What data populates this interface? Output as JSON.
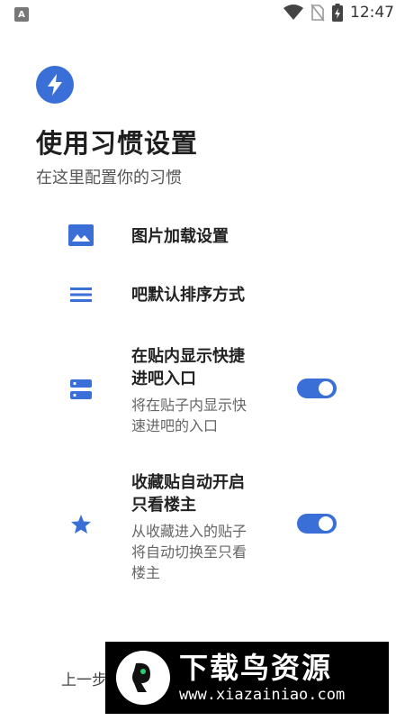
{
  "status_bar": {
    "notification_letter": "A",
    "time": "12:47",
    "icons": [
      "wifi-icon",
      "no-sim-icon",
      "battery-charging-icon"
    ]
  },
  "header": {
    "icon": "lightning-bolt-icon",
    "title": "使用习惯设置",
    "subtitle": "在这里配置你的习惯"
  },
  "settings": [
    {
      "icon": "image-icon",
      "title": "图片加载设置"
    },
    {
      "icon": "sort-list-icon",
      "title": "吧默认排序方式"
    },
    {
      "icon": "storage-icon",
      "title_lines": [
        "在贴内显示快捷",
        "进吧入口"
      ],
      "desc_lines": [
        "将在贴子内显示快",
        "速进吧的入口"
      ],
      "toggle_on": true
    },
    {
      "icon": "star-icon",
      "title_lines": [
        "收藏贴自动开启",
        "只看楼主"
      ],
      "desc_lines": [
        "从收藏进入的贴子",
        "将自动切换至只看",
        "楼主"
      ],
      "toggle_on": true
    }
  ],
  "footer": {
    "prev_label": "上一步"
  },
  "watermark": {
    "title": "下载鸟资源",
    "url": "www.xiazainiao.com"
  },
  "colors": {
    "accent": "#3b6fd8",
    "watermark_bg": "#000000"
  }
}
